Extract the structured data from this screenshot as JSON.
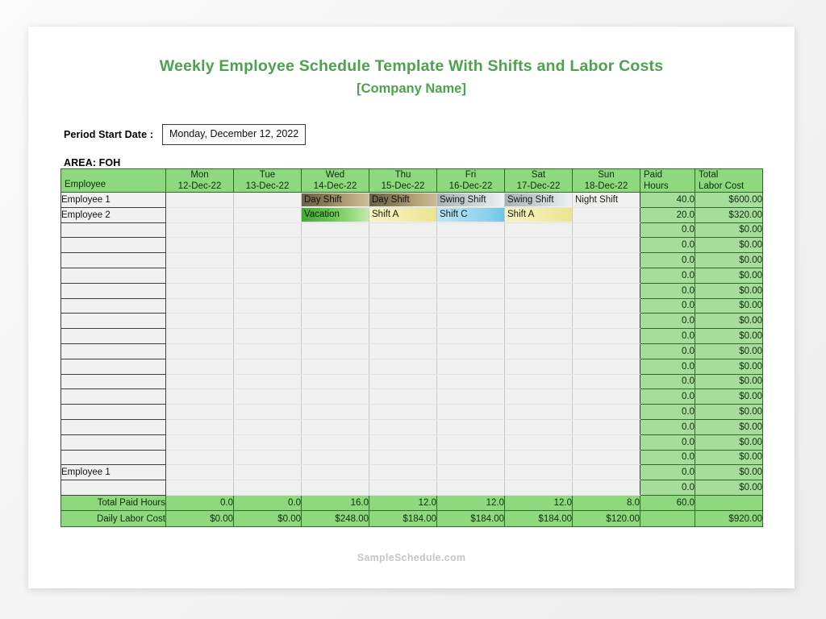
{
  "document": {
    "title": "Weekly Employee Schedule Template With Shifts and Labor Costs",
    "subtitle": "[Company Name]",
    "footer": "SampleSchedule.com",
    "accent_color": "#4ea14e",
    "header_fill": "#8ed97e",
    "number_fill": "#a7dd9a"
  },
  "period": {
    "label": "Period Start Date :",
    "value": "Monday, December 12, 2022"
  },
  "area": {
    "label": "AREA: FOH"
  },
  "table": {
    "headers": {
      "employee": "Employee",
      "days": [
        {
          "day": "Mon",
          "date": "12-Dec-22"
        },
        {
          "day": "Tue",
          "date": "13-Dec-22"
        },
        {
          "day": "Wed",
          "date": "14-Dec-22"
        },
        {
          "day": "Thu",
          "date": "15-Dec-22"
        },
        {
          "day": "Fri",
          "date": "16-Dec-22"
        },
        {
          "day": "Sat",
          "date": "17-Dec-22"
        },
        {
          "day": "Sun",
          "date": "18-Dec-22"
        }
      ],
      "paid_hours_l1": "Paid",
      "paid_hours_l2": "Hours",
      "total_cost_l1": "Total",
      "total_cost_l2": "Labor Cost"
    },
    "rows": [
      {
        "employee": "Employee 1",
        "shifts": [
          {
            "text": "",
            "style": ""
          },
          {
            "text": "",
            "style": ""
          },
          {
            "text": "Day Shift",
            "style": "day"
          },
          {
            "text": "Day Shift",
            "style": "day"
          },
          {
            "text": "Swing Shift",
            "style": "swing"
          },
          {
            "text": "Swing Shift",
            "style": "swing"
          },
          {
            "text": "Night Shift",
            "style": "night"
          }
        ],
        "paid_hours": "40.0",
        "labor_cost": "$600.00"
      },
      {
        "employee": "Employee 2",
        "shifts": [
          {
            "text": "",
            "style": ""
          },
          {
            "text": "",
            "style": ""
          },
          {
            "text": "Vacation",
            "style": "vacation"
          },
          {
            "text": "Shift A",
            "style": "a"
          },
          {
            "text": "Shift C",
            "style": "c"
          },
          {
            "text": "Shift A",
            "style": "a"
          },
          {
            "text": "",
            "style": ""
          }
        ],
        "paid_hours": "20.0",
        "labor_cost": "$320.00"
      },
      {
        "employee": "",
        "shifts": [],
        "paid_hours": "0.0",
        "labor_cost": "$0.00"
      },
      {
        "employee": "",
        "shifts": [],
        "paid_hours": "0.0",
        "labor_cost": "$0.00"
      },
      {
        "employee": "",
        "shifts": [],
        "paid_hours": "0.0",
        "labor_cost": "$0.00"
      },
      {
        "employee": "",
        "shifts": [],
        "paid_hours": "0.0",
        "labor_cost": "$0.00"
      },
      {
        "employee": "",
        "shifts": [],
        "paid_hours": "0.0",
        "labor_cost": "$0.00"
      },
      {
        "employee": "",
        "shifts": [],
        "paid_hours": "0.0",
        "labor_cost": "$0.00"
      },
      {
        "employee": "",
        "shifts": [],
        "paid_hours": "0.0",
        "labor_cost": "$0.00"
      },
      {
        "employee": "",
        "shifts": [],
        "paid_hours": "0.0",
        "labor_cost": "$0.00"
      },
      {
        "employee": "",
        "shifts": [],
        "paid_hours": "0.0",
        "labor_cost": "$0.00"
      },
      {
        "employee": "",
        "shifts": [],
        "paid_hours": "0.0",
        "labor_cost": "$0.00"
      },
      {
        "employee": "",
        "shifts": [],
        "paid_hours": "0.0",
        "labor_cost": "$0.00"
      },
      {
        "employee": "",
        "shifts": [],
        "paid_hours": "0.0",
        "labor_cost": "$0.00"
      },
      {
        "employee": "",
        "shifts": [],
        "paid_hours": "0.0",
        "labor_cost": "$0.00"
      },
      {
        "employee": "",
        "shifts": [],
        "paid_hours": "0.0",
        "labor_cost": "$0.00"
      },
      {
        "employee": "",
        "shifts": [],
        "paid_hours": "0.0",
        "labor_cost": "$0.00"
      },
      {
        "employee": "",
        "shifts": [],
        "paid_hours": "0.0",
        "labor_cost": "$0.00"
      },
      {
        "employee": "Employee 1",
        "shifts": [],
        "paid_hours": "0.0",
        "labor_cost": "$0.00"
      },
      {
        "employee": "",
        "shifts": [],
        "paid_hours": "0.0",
        "labor_cost": "$0.00"
      }
    ],
    "totals": {
      "paid_hours_label": "Total Paid Hours",
      "paid_hours_values": [
        "0.0",
        "0.0",
        "16.0",
        "12.0",
        "12.0",
        "12.0",
        "8.0"
      ],
      "paid_hours_grand": "60.0",
      "paid_hours_cost_blank": "",
      "labor_cost_label": "Daily Labor Cost",
      "labor_cost_values": [
        "$0.00",
        "$0.00",
        "$248.00",
        "$184.00",
        "$184.00",
        "$184.00",
        "$120.00"
      ],
      "labor_cost_hours_blank": "",
      "labor_cost_grand": "$920.00"
    }
  }
}
